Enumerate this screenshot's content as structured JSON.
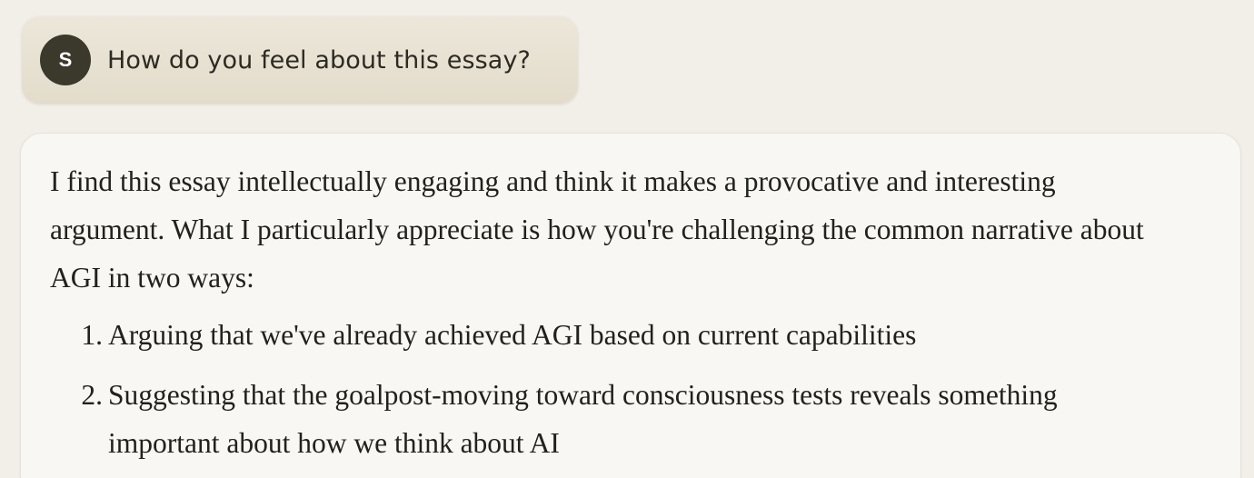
{
  "conversation": {
    "user_message": {
      "avatar_initial": "S",
      "text": "How do you feel about this essay?"
    },
    "assistant_message": {
      "paragraph": "I find this essay intellectually engaging and think it makes a provocative and interesting argument. What I particularly appreciate is how you're challenging the common narrative about AGI in two ways:",
      "list": [
        {
          "number": "1.",
          "text": "Arguing that we've already achieved AGI based on current capabilities"
        },
        {
          "number": "2.",
          "text": "Suggesting that the goalpost-moving toward consciousness tests reveals something important about how we think about AI"
        }
      ]
    }
  },
  "colors": {
    "page_background": "#f1efe8",
    "user_bubble": "#e6e0d1",
    "avatar_background": "#3b382c",
    "assistant_bubble": "#f8f7f4",
    "text": "#22211c"
  }
}
